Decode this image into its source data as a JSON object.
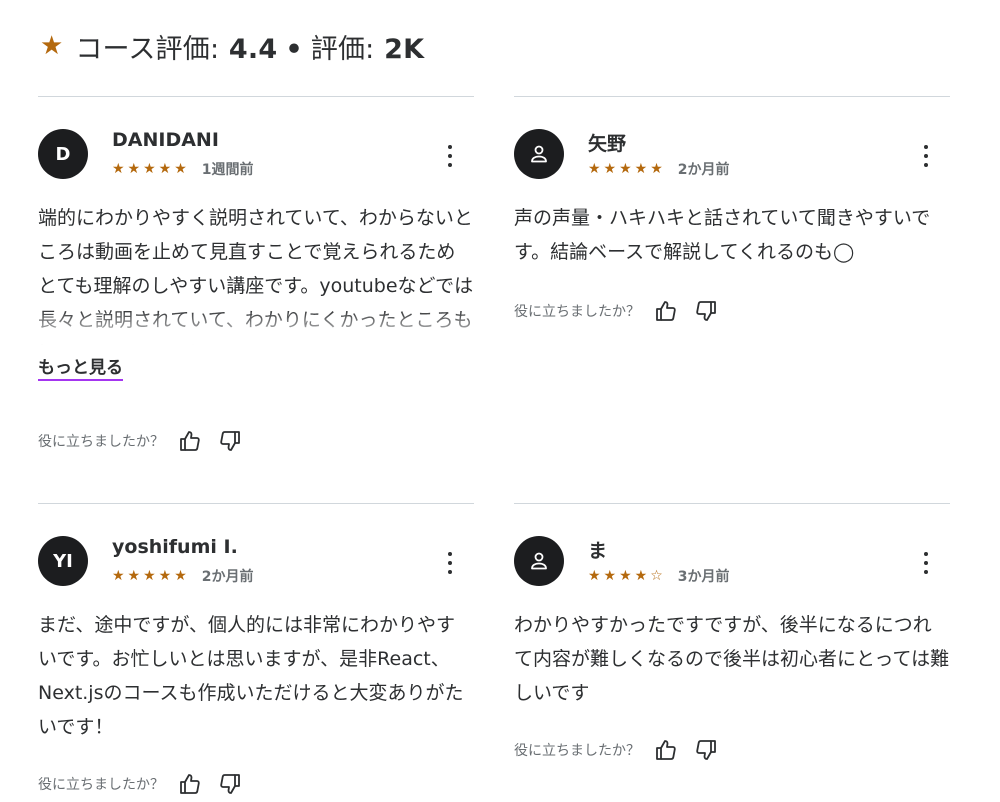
{
  "header": {
    "star_icon": "star-icon",
    "label1": "コース評価:",
    "rating": "4.4",
    "separator": "•",
    "label2": "評価:",
    "count": "2K"
  },
  "helpful_prompt": "役に立ちましたか？",
  "colors": {
    "star": "#b4690e",
    "avatar_bg": "#1c1d1f",
    "divider": "#d1d7dc",
    "link_underline": "#a435f0"
  },
  "reviews": [
    {
      "avatar_initials": "D",
      "name": "DANIDANI",
      "stars": "★★★★★",
      "rating": 5,
      "time": "1週間前",
      "text": "端的にわかりやすく説明されていて、わからないところは動画を止めて見直すことで覚えられるためとても理解のしやすい講座です。youtubeなどでは長々と説明されていて、わかりにくかったところも押さえて一回で理解",
      "more_label": "もっと見る"
    },
    {
      "avatar_icon": "user-icon",
      "name": "矢野",
      "stars": "★★★★★",
      "rating": 5,
      "time": "2か月前",
      "text": "声の声量・ハキハキと話されていて聞きやすいです。結論ベースで解説してくれるのも◯"
    },
    {
      "avatar_initials": "YI",
      "name": "yoshifumi I.",
      "stars": "★★★★★",
      "rating": 5,
      "time": "2か月前",
      "text": "まだ、途中ですが、個人的には非常にわかりやすいです。お忙しいとは思いますが、是非React、Next.jsのコースも作成いただけると大変ありがたいです！"
    },
    {
      "avatar_icon": "user-icon",
      "name": "ま",
      "stars": "★★★★☆",
      "rating": 4,
      "time": "3か月前",
      "text": "わかりやすかったですですが、後半になるにつれて内容が難しくなるので後半は初心者にとっては難しいです"
    }
  ]
}
